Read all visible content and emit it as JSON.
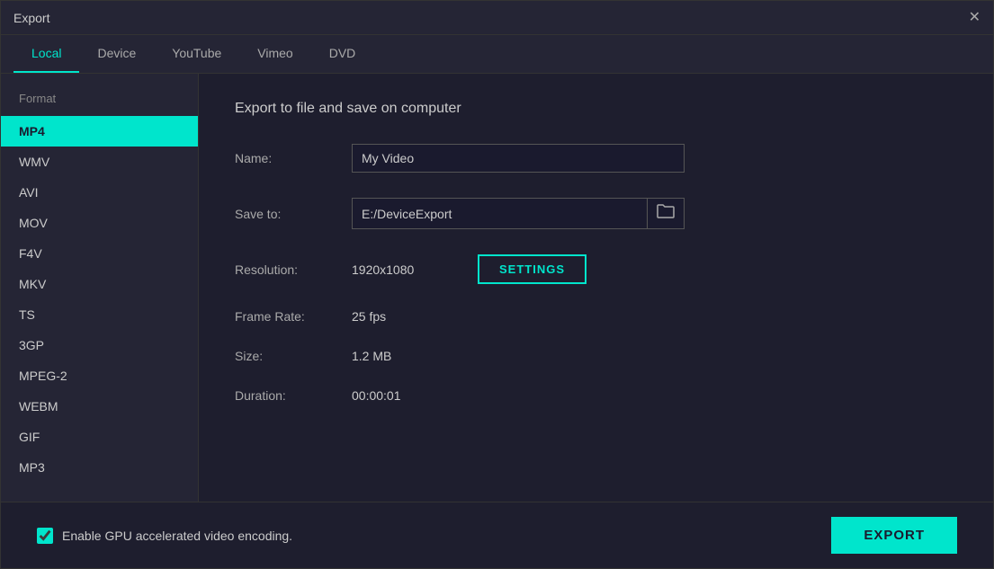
{
  "window": {
    "title": "Export",
    "close_label": "✕"
  },
  "tabs": [
    {
      "id": "local",
      "label": "Local",
      "active": true
    },
    {
      "id": "device",
      "label": "Device",
      "active": false
    },
    {
      "id": "youtube",
      "label": "YouTube",
      "active": false
    },
    {
      "id": "vimeo",
      "label": "Vimeo",
      "active": false
    },
    {
      "id": "dvd",
      "label": "DVD",
      "active": false
    }
  ],
  "sidebar": {
    "section_label": "Format",
    "items": [
      {
        "id": "mp4",
        "label": "MP4",
        "active": true
      },
      {
        "id": "wmv",
        "label": "WMV",
        "active": false
      },
      {
        "id": "avi",
        "label": "AVI",
        "active": false
      },
      {
        "id": "mov",
        "label": "MOV",
        "active": false
      },
      {
        "id": "f4v",
        "label": "F4V",
        "active": false
      },
      {
        "id": "mkv",
        "label": "MKV",
        "active": false
      },
      {
        "id": "ts",
        "label": "TS",
        "active": false
      },
      {
        "id": "3gp",
        "label": "3GP",
        "active": false
      },
      {
        "id": "mpeg2",
        "label": "MPEG-2",
        "active": false
      },
      {
        "id": "webm",
        "label": "WEBM",
        "active": false
      },
      {
        "id": "gif",
        "label": "GIF",
        "active": false
      },
      {
        "id": "mp3",
        "label": "MP3",
        "active": false
      }
    ]
  },
  "content": {
    "title": "Export to file and save on computer",
    "name_label": "Name:",
    "name_value": "My Video",
    "save_to_label": "Save to:",
    "save_to_value": "E:/DeviceExport",
    "resolution_label": "Resolution:",
    "resolution_value": "1920x1080",
    "settings_button": "SETTINGS",
    "frame_rate_label": "Frame Rate:",
    "frame_rate_value": "25 fps",
    "size_label": "Size:",
    "size_value": "1.2 MB",
    "duration_label": "Duration:",
    "duration_value": "00:00:01"
  },
  "bottom": {
    "gpu_label": "Enable GPU accelerated video encoding.",
    "export_button": "EXPORT"
  },
  "icons": {
    "folder": "🗁",
    "close": "✕"
  }
}
